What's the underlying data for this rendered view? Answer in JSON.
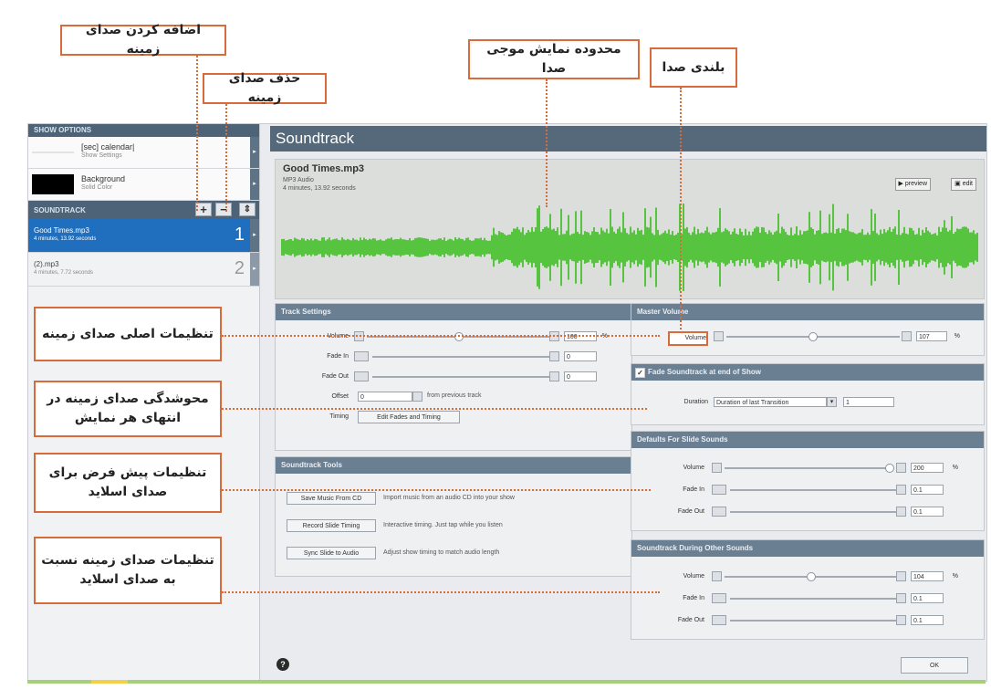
{
  "callouts": {
    "add_bg": "اضافه کردن صدای زمینه",
    "remove_bg": "حذف صدای زمینه",
    "wave_area": "محدوده نمایش موجی صدا",
    "loudness": "بلندی صدا",
    "main_settings": "تنظیمات اصلی صدای زمینه",
    "fade_line1": "محوشدگی صدای زمینه در",
    "fade_line2": "انتهای هر نمایش",
    "defaults_line1": "تنظیمات پیش فرض برای",
    "defaults_line2": "صدای اسلاید",
    "relative_line1": "تنظیمات صدای زمینه نسبت",
    "relative_line2": "به صدای اسلاید"
  },
  "sidebar": {
    "show_options_header": "SHOW OPTIONS",
    "options": [
      {
        "title": "[sec] calendar|",
        "sub": "Show Settings"
      },
      {
        "title": "Background",
        "sub": "Solid Color"
      }
    ],
    "soundtrack_header": "SOUNDTRACK",
    "buttons": {
      "add": "+",
      "remove": "−",
      "order": "⇕"
    },
    "tracks": [
      {
        "name": "Good Times.mp3",
        "duration": "4 minutes, 13.92 seconds",
        "num": "1"
      },
      {
        "name": "(2).mp3",
        "duration": "4 minutes, 7.72 seconds",
        "num": "2"
      }
    ]
  },
  "main": {
    "title": "Soundtrack",
    "file": {
      "name": "Good Times.mp3",
      "type": "MP3 Audio",
      "duration": "4 minutes, 13.92 seconds"
    },
    "buttons": {
      "preview": "▶ preview",
      "edit": "edit"
    }
  },
  "track_settings": {
    "header": "Track Settings",
    "volume_label": "Volume",
    "volume_value": "100",
    "volume_unit": "%",
    "fade_in_label": "Fade In",
    "fade_in_value": "0",
    "fade_out_label": "Fade Out",
    "fade_out_value": "0",
    "offset_label": "Offset",
    "offset_value": "0",
    "offset_desc": "from previous track",
    "timing_label": "Timing",
    "timing_button": "Edit Fades and Timing"
  },
  "soundtrack_tools": {
    "header": "Soundtrack Tools",
    "tools": [
      {
        "button": "Save Music From CD",
        "desc": "Import music from an audio CD into your show"
      },
      {
        "button": "Record Slide Timing",
        "desc": "Interactive timing. Just tap while you listen"
      },
      {
        "button": "Sync Slide to Audio",
        "desc": "Adjust show timing to match audio length"
      }
    ]
  },
  "master_volume": {
    "header": "Master Volume",
    "volume_label": "Volume",
    "value": "107",
    "unit": "%"
  },
  "fade_end": {
    "header": "Fade Soundtrack at end of Show",
    "duration_label": "Duration",
    "duration_select": "Duration of last Transition",
    "duration_value": "1"
  },
  "defaults_slide": {
    "header": "Defaults For Slide Sounds",
    "volume_label": "Volume",
    "volume_value": "200",
    "unit": "%",
    "fade_in_label": "Fade In",
    "fade_in_value": "0.1",
    "fade_out_label": "Fade Out",
    "fade_out_value": "0.1"
  },
  "during_other": {
    "header": "Soundtrack During Other Sounds",
    "volume_label": "Volume",
    "volume_value": "104",
    "unit": "%",
    "fade_in_label": "Fade In",
    "fade_in_value": "0.1",
    "fade_out_label": "Fade Out",
    "fade_out_value": "0.1"
  },
  "footer": {
    "ok": "OK",
    "help": "?"
  },
  "colors": {
    "waveform": "#56c43f",
    "callout_border": "#d96a3a",
    "header": "#4d6478",
    "selected": "#1f6fbe"
  }
}
